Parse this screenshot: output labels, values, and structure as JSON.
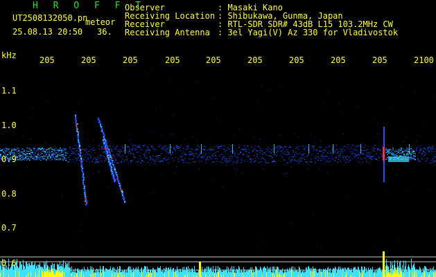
{
  "header": {
    "station_code": "H R O F F T",
    "file_name": "UT2508132050.pn",
    "meteor_label": "meteor",
    "date_time": "25.08.13 20:50",
    "count": "36."
  },
  "info": [
    {
      "label": "Observer",
      "value": ": Masaki Kano"
    },
    {
      "label": "Receiving Location",
      "value": ": Shibukawa, Gunma, Japan"
    },
    {
      "label": "Receiver",
      "value": ": RTL-SDR SDR# 43dB L15 103.2MHz CW"
    },
    {
      "label": "Receiving Antenna",
      "value": ": 3el Yagi(V) Az 330 for Vladivostok"
    }
  ],
  "axes": {
    "y_unit": "kHz",
    "x_ticks": [
      "205",
      "205",
      "205",
      "205",
      "205",
      "205",
      "205",
      "205",
      "205",
      "2100"
    ],
    "y_ticks": [
      "1.1",
      "1.0",
      "0.9",
      "0.8",
      "0.7",
      "0.6"
    ]
  },
  "colors": {
    "background": "#000000",
    "text_yellow": "#ffff40",
    "text_green": "#30e030",
    "signal_blue": "#2050ff",
    "signal_cyan": "#40e0ff",
    "signal_red": "#ff3040",
    "level_yellow": "#ffff00"
  }
}
